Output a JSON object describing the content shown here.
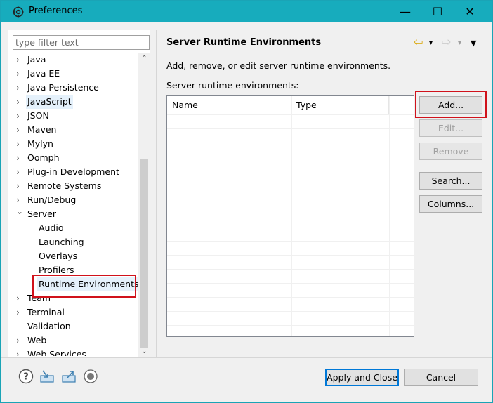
{
  "window": {
    "title": "Preferences",
    "minimize_glyph": "—",
    "maximize_glyph": "☐",
    "close_glyph": "✕"
  },
  "filter": {
    "placeholder": "type filter text",
    "value": ""
  },
  "tree": {
    "items": [
      {
        "label": "Java",
        "expander": "›"
      },
      {
        "label": "Java EE",
        "expander": "›"
      },
      {
        "label": "Java Persistence",
        "expander": "›"
      },
      {
        "label": "JavaScript",
        "expander": "›"
      },
      {
        "label": "JSON",
        "expander": "›"
      },
      {
        "label": "Maven",
        "expander": "›"
      },
      {
        "label": "Mylyn",
        "expander": "›"
      },
      {
        "label": "Oomph",
        "expander": "›"
      },
      {
        "label": "Plug-in Development",
        "expander": "›"
      },
      {
        "label": "Remote Systems",
        "expander": "›"
      },
      {
        "label": "Run/Debug",
        "expander": "›"
      },
      {
        "label": "Server",
        "expander": "⌄"
      },
      {
        "label": "Audio"
      },
      {
        "label": "Launching"
      },
      {
        "label": "Overlays"
      },
      {
        "label": "Profilers"
      },
      {
        "label": "Runtime Environments"
      },
      {
        "label": "Team",
        "expander": "›"
      },
      {
        "label": "Terminal",
        "expander": "›"
      },
      {
        "label": "Validation"
      },
      {
        "label": "Web",
        "expander": "›"
      },
      {
        "label": "Web Services",
        "expander": "›"
      }
    ]
  },
  "scrollbar": {
    "up_glyph": "⌃",
    "down_glyph": "⌄"
  },
  "page": {
    "title": "Server Runtime Environments",
    "description": "Add, remove, or edit server runtime environments.",
    "env_label": "Server runtime environments:",
    "nav_back_glyph": "⇦",
    "nav_back_menu_glyph": "▾",
    "nav_forward_glyph": "⇨",
    "nav_forward_menu_glyph": "▾",
    "view_menu_glyph": "▼"
  },
  "table": {
    "columns": [
      "Name",
      "Type"
    ],
    "rows": []
  },
  "buttons": {
    "add": "Add...",
    "edit": "Edit...",
    "remove": "Remove",
    "search": "Search...",
    "columns": "Columns..."
  },
  "bottom": {
    "apply_close": "Apply and Close",
    "cancel": "Cancel"
  },
  "colors": {
    "titlebar": "#17acbd",
    "highlight": "#d0121b",
    "selection": "#e5f1fb",
    "primary_border": "#0078d7"
  }
}
